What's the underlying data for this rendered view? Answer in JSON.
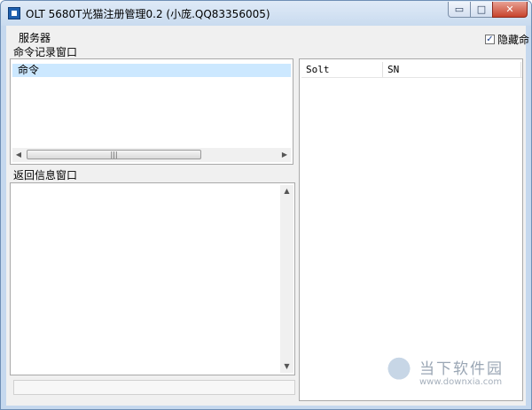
{
  "window": {
    "title": "OLT 5680T光猫注册管理0.2 (小庞.QQ83356005)",
    "controls": {
      "minimize": "▭",
      "maximize": "□",
      "close": "✕"
    }
  },
  "menu": {
    "server": "服务器"
  },
  "hide_checkbox": {
    "label": "隐藏命",
    "checked": true,
    "mark": "✓"
  },
  "command_log": {
    "title": "命令记录窗口",
    "items": [
      "命令"
    ],
    "scroll_left": "◀",
    "scroll_right": "▶",
    "thumb_grip": "|||"
  },
  "return_info": {
    "title": "返回信息窗口",
    "scroll_up": "▲",
    "scroll_down": "▼"
  },
  "result_table": {
    "columns": [
      "Solt",
      "SN"
    ]
  },
  "watermark": {
    "name": "当下软件园",
    "url": "www.downxia.com"
  },
  "icons": [
    "app-icon",
    "minimize-icon",
    "maximize-icon",
    "close-icon",
    "checkbox-icon"
  ]
}
